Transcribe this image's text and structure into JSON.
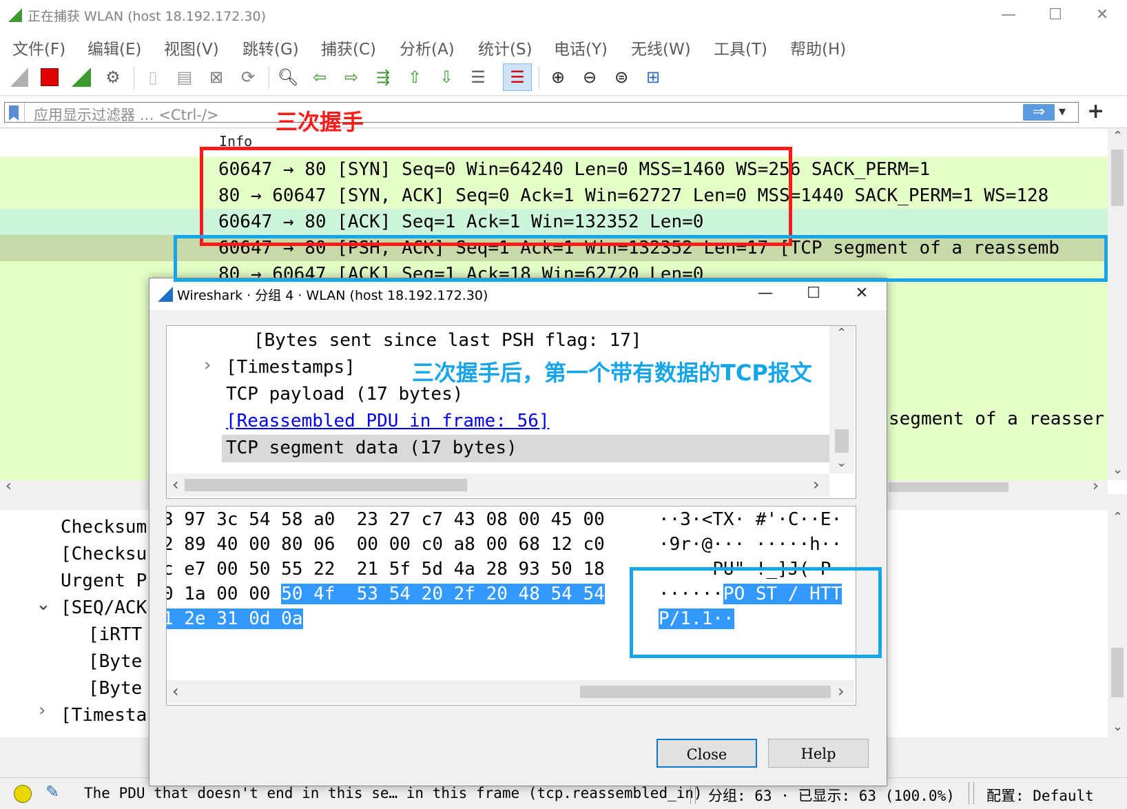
{
  "window": {
    "title": "正在捕获 WLAN (host 18.192.172.30)",
    "minimize": "—",
    "maximize": "☐",
    "close": "✕"
  },
  "menu": [
    "文件(F)",
    "编辑(E)",
    "视图(V)",
    "跳转(G)",
    "捕获(C)",
    "分析(A)",
    "统计(S)",
    "电话(Y)",
    "无线(W)",
    "工具(T)",
    "帮助(H)"
  ],
  "filter": {
    "placeholder": "应用显示过滤器 … <Ctrl-/>",
    "apply_arrow": "⇒",
    "dropdown": "▾",
    "add": "+"
  },
  "packet_list": {
    "column_header": "Info",
    "rows": [
      "60647 → 80 [SYN] Seq=0 Win=64240 Len=0 MSS=1460 WS=256 SACK_PERM=1",
      "80 → 60647 [SYN, ACK] Seq=0 Ack=1 Win=62727 Len=0 MSS=1440 SACK_PERM=1 WS=128",
      "60647 → 80 [ACK] Seq=1 Ack=1 Win=132352 Len=0",
      "60647 → 80 [PSH, ACK] Seq=1 Ack=1 Win=132352 Len=17 [TCP segment of a reassemb",
      "80 → 60647 [ACK] Seq=1 Ack=18 Win=62720 Len=0",
      "segment of a reasser"
    ]
  },
  "detail_tree": {
    "items": [
      "Checksum",
      "[Checksu",
      "Urgent P",
      "[SEQ/ACK",
      "[iRTT",
      "[Byte",
      "[Byte",
      "[Timesta"
    ],
    "expanded_marker": "⌄",
    "collapsed_marker": "›"
  },
  "status": {
    "message": "The PDU that doesn't end in this se… in this frame (tcp.reassembled_in)",
    "packets": "分组: 63 · 已显示: 63 (100.0%)",
    "profile": "配置: Default"
  },
  "dialog": {
    "title": "Wireshark · 分组 4 · WLAN (host 18.192.172.30)",
    "tree": [
      {
        "text": "[Bytes sent since last PSH flag: 17]",
        "indent": 2
      },
      {
        "text": "[Timestamps]",
        "indent": 1,
        "marker": "›"
      },
      {
        "text": "TCP payload (17 bytes)",
        "indent": 1
      },
      {
        "text": "[Reassembled PDU in frame: 56]",
        "indent": 1,
        "link": true
      },
      {
        "text": "TCP segment data (17 bytes)",
        "indent": 1,
        "selected": true
      }
    ],
    "hex_rows": [
      {
        "hex": "3 97 3c 54 58 a0  23 27 c7 43 08 00 45 00",
        "ascii": "··3·<TX· #'·C··E·"
      },
      {
        "hex": "2 89 40 00 80 06  00 00 c0 a8 00 68 12 c0",
        "ascii": "·9r·@··· ·····h··"
      },
      {
        "hex": "c e7 00 50 55 22  21 5f 5d 4a 28 93 50 18",
        "ascii": "·····PU\" !_]J(·P·"
      },
      {
        "hex_plain": "0 1a 00 00 ",
        "hex_sel": "50 4f  53 54 20 2f 20 48 54 54",
        "ascii_plain": "······",
        "ascii_sel": "PO ST / HTT"
      },
      {
        "hex_sel": "1 2e 31 0d 0a",
        "ascii_sel": "P/1.1··"
      }
    ],
    "close_button": "Close",
    "help_button": "Help"
  },
  "annotations": {
    "handshake": "三次握手",
    "first_data": "三次握手后，第一个带有数据的TCP报文"
  },
  "colors": {
    "row_green": "#e4ffc7",
    "row_teal": "#ccf5dc",
    "row_selected": "#c8d9a8",
    "annotation_red": "#ff1a1a",
    "annotation_blue": "#16a5e8",
    "hex_selection": "#3399ff"
  }
}
